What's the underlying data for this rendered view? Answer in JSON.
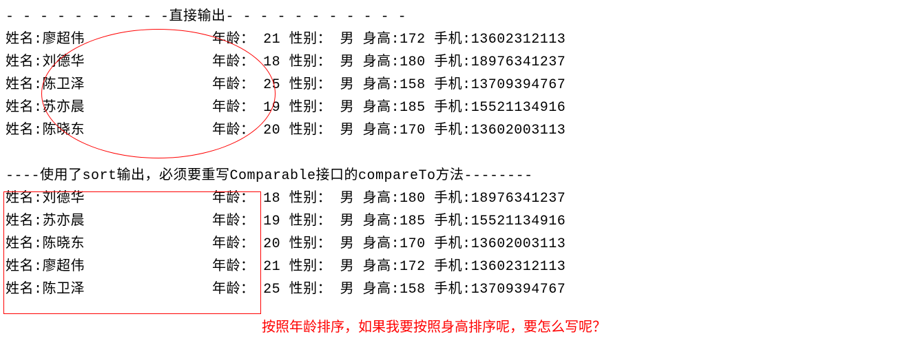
{
  "section1": {
    "title": "- - - - - - - - - -直接输出- - - - - - - - - - -",
    "labels": {
      "name": "姓名:",
      "age": "年龄：",
      "gender": "性别：",
      "height": "身高:",
      "phone": "手机:"
    },
    "rows": [
      {
        "name": "廖超伟",
        "age": "21",
        "gender": "男",
        "height": "172",
        "phone": "13602312113"
      },
      {
        "name": "刘德华",
        "age": "18",
        "gender": "男",
        "height": "180",
        "phone": "18976341237"
      },
      {
        "name": "陈卫泽",
        "age": "25",
        "gender": "男",
        "height": "158",
        "phone": "13709394767"
      },
      {
        "name": "苏亦晨",
        "age": "19",
        "gender": "男",
        "height": "185",
        "phone": "15521134916"
      },
      {
        "name": "陈晓东",
        "age": "20",
        "gender": "男",
        "height": "170",
        "phone": "13602003113"
      }
    ]
  },
  "section2": {
    "title": "----使用了sort输出，必须要重写Comparable接口的compareTo方法--------",
    "rows": [
      {
        "name": "刘德华",
        "age": "18",
        "gender": "男",
        "height": "180",
        "phone": "18976341237"
      },
      {
        "name": "苏亦晨",
        "age": "19",
        "gender": "男",
        "height": "185",
        "phone": "15521134916"
      },
      {
        "name": "陈晓东",
        "age": "20",
        "gender": "男",
        "height": "170",
        "phone": "13602003113"
      },
      {
        "name": "廖超伟",
        "age": "21",
        "gender": "男",
        "height": "172",
        "phone": "13602312113"
      },
      {
        "name": "陈卫泽",
        "age": "25",
        "gender": "男",
        "height": "158",
        "phone": "13709394767"
      }
    ]
  },
  "annotation_text": "按照年龄排序，如果我要按照身高排序呢，要怎么写呢？"
}
